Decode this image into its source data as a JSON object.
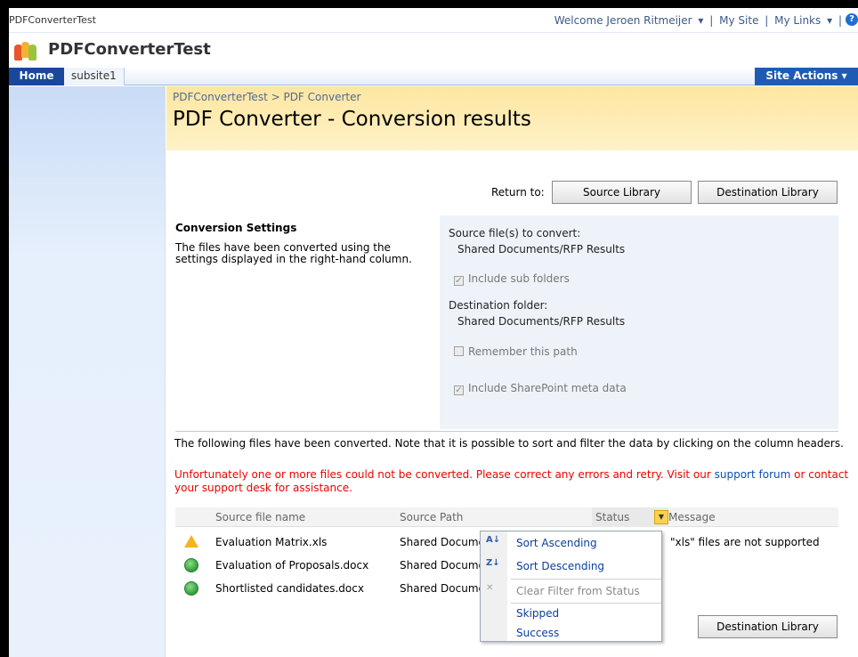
{
  "global": {
    "site_small": "PDFConverterTest",
    "welcome": "Welcome Jeroen Ritmeijer",
    "my_site": "My Site",
    "my_links": "My Links",
    "separator": "|"
  },
  "site_title": "PDFConverterTest",
  "topnav": {
    "home": "Home",
    "subsite": "subsite1",
    "site_actions": "Site Actions"
  },
  "breadcrumb": "PDFConverterTest > PDF Converter",
  "page_title": "PDF Converter - Conversion results",
  "return": {
    "label": "Return to:",
    "source": "Source Library",
    "destination": "Destination Library"
  },
  "settings": {
    "title": "Conversion Settings",
    "description": "The files have been converted using the settings displayed in the right-hand column.",
    "source_label": "Source file(s) to convert:",
    "source_value": "Shared Documents/RFP Results",
    "include_sub": "Include sub folders",
    "dest_label": "Destination folder:",
    "dest_value": "Shared Documents/RFP Results",
    "remember": "Remember this path",
    "include_meta": "Include SharePoint meta data"
  },
  "info_text": "The following files have been converted. Note that it is possible to sort and filter the data by clicking on the column headers.",
  "warning": {
    "text1": "Unfortunately one or more files could not be converted. Please correct any errors and retry. Visit our ",
    "support_link": "support forum",
    "text2": " or contact your support desk for assistance."
  },
  "table": {
    "headers": [
      "Source file name",
      "Source Path",
      "Status",
      "Message"
    ],
    "rows": [
      {
        "name": "Evaluation Matrix.xls",
        "path": "Shared Docume",
        "message": "\"xls\" files are not supported"
      },
      {
        "name": "Evaluation of Proposals.docx",
        "path": "Shared Docume",
        "message": ""
      },
      {
        "name": "Shortlisted candidates.docx",
        "path": "Shared Docume",
        "message": ""
      }
    ]
  },
  "menu": {
    "sort_asc": "Sort Ascending",
    "sort_desc": "Sort Descending",
    "clear_filter": "Clear Filter from Status",
    "skipped": "Skipped",
    "success": "Success"
  },
  "bottom_button": "Destination Library"
}
